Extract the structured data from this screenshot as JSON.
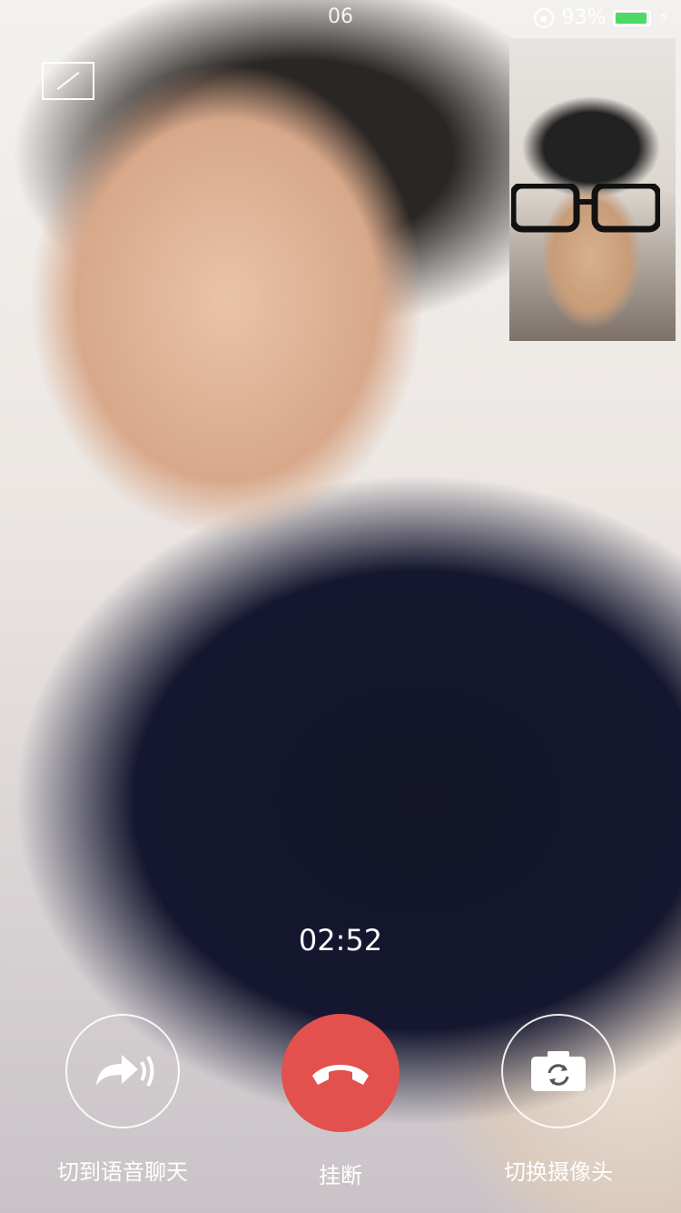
{
  "status": {
    "time": "06",
    "battery": "93%",
    "battery_level": 0.93,
    "colors": {
      "battery": "#4cd964"
    }
  },
  "call": {
    "timer": "02:52"
  },
  "controls": [
    {
      "label": "切到语音聊天",
      "icon": "voice-switch-icon"
    },
    {
      "label": "挂断",
      "icon": "hangup-icon"
    },
    {
      "label": "切换摄像头",
      "icon": "camera-switch-icon"
    }
  ],
  "colors": {
    "hangup": "#e2514e"
  }
}
